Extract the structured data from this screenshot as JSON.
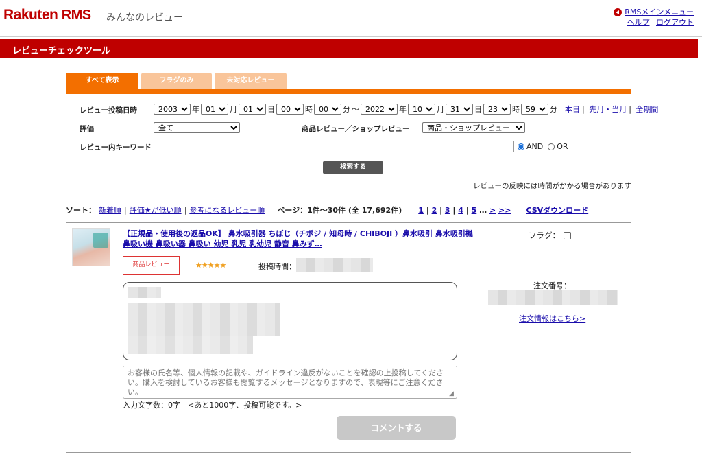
{
  "header": {
    "logo_main": "Rakuten",
    "logo_rms": "RMS",
    "logo_sub": "みんなのレビュー",
    "rms_menu": "RMSメインメニュー",
    "help": "ヘルプ",
    "logout": "ログアウト"
  },
  "title_bar": "レビューチェックツール",
  "tabs": [
    {
      "label": "すべて表示",
      "active": true
    },
    {
      "label": "フラグのみ",
      "active": false
    },
    {
      "label": "未対応レビュー",
      "active": false
    }
  ],
  "filter": {
    "date_label": "レビュー投稿日時",
    "from": {
      "year": "2003",
      "month": "01",
      "day": "01",
      "hour": "00",
      "minute": "00"
    },
    "to": {
      "year": "2022",
      "month": "10",
      "day": "31",
      "hour": "23",
      "minute": "59"
    },
    "units": {
      "year": "年",
      "month": "月",
      "day": "日",
      "hour": "時",
      "minute": "分",
      "tilde": "～"
    },
    "quick_links": [
      "本日",
      "先月・当月",
      "全期間"
    ],
    "rating_label": "評価",
    "rating_value": "全て",
    "review_type_label": "商品レビュー／ショップレビュー",
    "review_type_value": "商品・ショップレビュー",
    "keyword_label": "レビュー内キーワード",
    "keyword_value": "",
    "and_label": "AND",
    "or_label": "OR",
    "search_button": "検索する",
    "note": "レビューの反映には時間がかかる場合があります"
  },
  "sort": {
    "label": "ソート：",
    "options": [
      "新着順",
      "評価★が低い順",
      "参考になるレビュー順"
    ],
    "page_info": "ページ：1件〜30件 (全 17,692件)",
    "pages": [
      "1",
      "2",
      "3",
      "4",
      "5"
    ],
    "ellipsis": "…",
    "next": ">",
    "last": ">>",
    "csv": "CSVダウンロード"
  },
  "review": {
    "product_title": "【正規品・使用後の返品OK】 鼻水吸引器 ちぼじ（チボジ / 知母時 / CHIBOJI ）鼻水吸引 鼻水吸引機 鼻吸い機 鼻吸い器 鼻吸い 幼児 乳児 乳幼児 静音 鼻みず…",
    "flag_label": "フラグ：",
    "type_badge": "商品レビュー",
    "stars": "★★★★★",
    "rating": 5,
    "post_time_label": "投稿時間：",
    "order_label": "注文番号：",
    "order_link": "注文情報はこちら>",
    "comment_placeholder": "お客様の氏名等、個人情報の記載や、ガイドライン違反がないことを確認の上投稿してください。購入を検討しているお客様も閲覧するメッセージとなりますので、表現等にご注意ください。",
    "char_count": "入力文字数：0字　<あと1000字、投稿可能です。>",
    "comment_button": "コメントする"
  },
  "colors": {
    "brand_red": "#bf0000",
    "tab_orange": "#f36f00",
    "tab_light": "#f9c59a",
    "link": "#1a0dab"
  }
}
